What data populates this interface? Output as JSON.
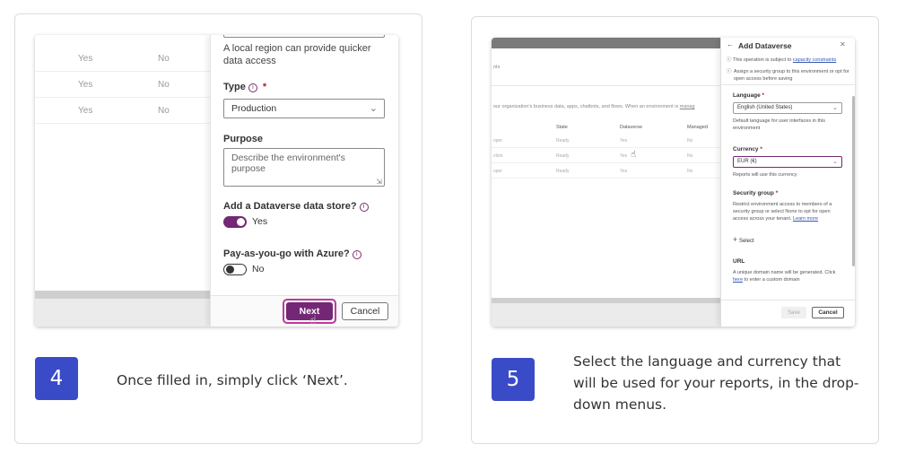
{
  "step4": {
    "number": "4",
    "caption": "Once filled in, simply click ‘Next’.",
    "table_rows": [
      {
        "col1": "Yes",
        "col2": "No"
      },
      {
        "col1": "Yes",
        "col2": "No"
      },
      {
        "col1": "Yes",
        "col2": "No"
      }
    ],
    "region_help": "A local region can provide quicker data access",
    "type_label": "Type",
    "type_required": "*",
    "type_value": "Production",
    "purpose_label": "Purpose",
    "purpose_placeholder": "Describe the environment's purpose",
    "dataverse_label": "Add a Dataverse data store?",
    "dataverse_toggle_text": "Yes",
    "payg_label": "Pay-as-you-go with Azure?",
    "payg_toggle_text": "No",
    "next_label": "Next",
    "cancel_label": "Cancel"
  },
  "step5": {
    "number": "5",
    "caption": "Select the language and currency that will be used for your reports, in the drop-down menus.",
    "bg_breadcrumb": "nts",
    "bg_description": "our organization's business data, apps, chatbots, and flows. When an environment is",
    "bg_description_link": "manag",
    "bg_columns": [
      "State",
      "Dataverse",
      "Managed"
    ],
    "bg_rows": [
      {
        "name": "oper",
        "state": "Ready",
        "dataverse": "Yes",
        "managed": "No"
      },
      {
        "name": "ction",
        "state": "Ready",
        "dataverse": "Yes",
        "managed": "No"
      },
      {
        "name": "oper",
        "state": "Ready",
        "dataverse": "Yes",
        "managed": "No"
      }
    ],
    "panel_title": "Add Dataverse",
    "notice1": "This operation is subject to",
    "notice1_link": "capacity constraints",
    "notice2": "Assign a security group to this environment or opt for open access before saving",
    "language_label": "Language",
    "language_value": "English (United States)",
    "language_help": "Default language for user interfaces in this environment",
    "currency_label": "Currency",
    "currency_value": "EUR (€)",
    "currency_help": "Reports will use this currency",
    "security_label": "Security group",
    "security_help": "Restrict environment access to members of a security group or select None to opt for open access across your tenant.",
    "security_help_link": "Learn more",
    "select_label": "Select",
    "url_label": "URL",
    "url_help": "A unique domain name will be generated. Click",
    "url_help_link": "here",
    "url_help_end": "to enter a custom domain",
    "required_mark": "*",
    "save_label": "Save",
    "cancel_label": "Cancel"
  },
  "colors": {
    "badge": "#3a4bc8",
    "accent": "#742774",
    "highlight": "#c0399b"
  }
}
